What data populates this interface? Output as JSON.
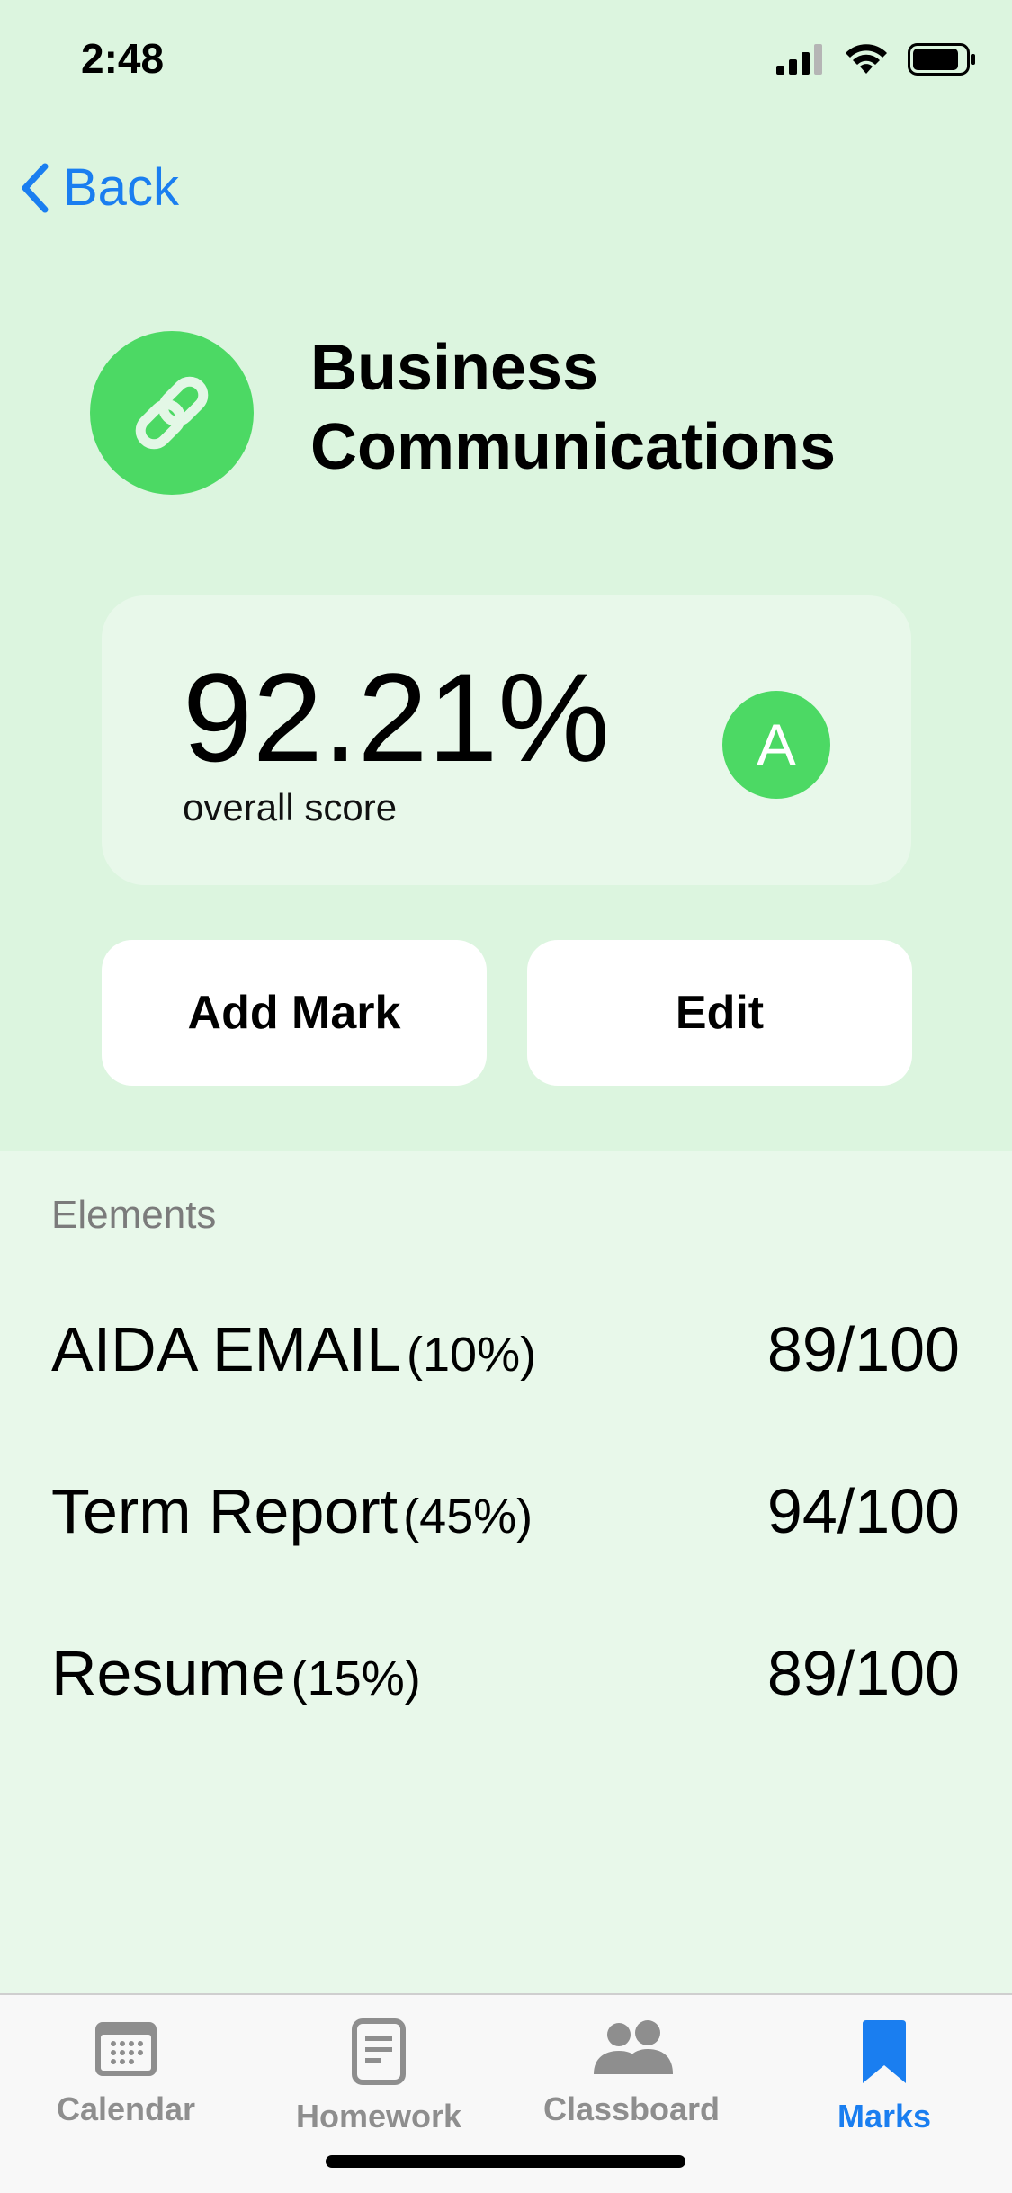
{
  "status_bar": {
    "time": "2:48"
  },
  "nav": {
    "back_label": "Back"
  },
  "course": {
    "title_line1": "Business",
    "title_line2": "Communications",
    "icon": "link-icon",
    "accent_color": "#4cd964"
  },
  "score": {
    "value": "92.21%",
    "label": "overall score",
    "grade": "A"
  },
  "actions": {
    "add_mark": "Add Mark",
    "edit": "Edit"
  },
  "elements": {
    "section_label": "Elements",
    "items": [
      {
        "name": "AIDA EMAIL",
        "weight": "(10%)",
        "score": "89/100"
      },
      {
        "name": "Term Report",
        "weight": "(45%)",
        "score": "94/100"
      },
      {
        "name": "Resume",
        "weight": "(15%)",
        "score": "89/100"
      }
    ]
  },
  "tabbar": {
    "tabs": [
      {
        "label": "Calendar",
        "icon": "calendar-icon",
        "active": false
      },
      {
        "label": "Homework",
        "icon": "document-icon",
        "active": false
      },
      {
        "label": "Classboard",
        "icon": "people-icon",
        "active": false
      },
      {
        "label": "Marks",
        "icon": "bookmark-icon",
        "active": true
      }
    ],
    "active_color": "#1a7ef0"
  }
}
